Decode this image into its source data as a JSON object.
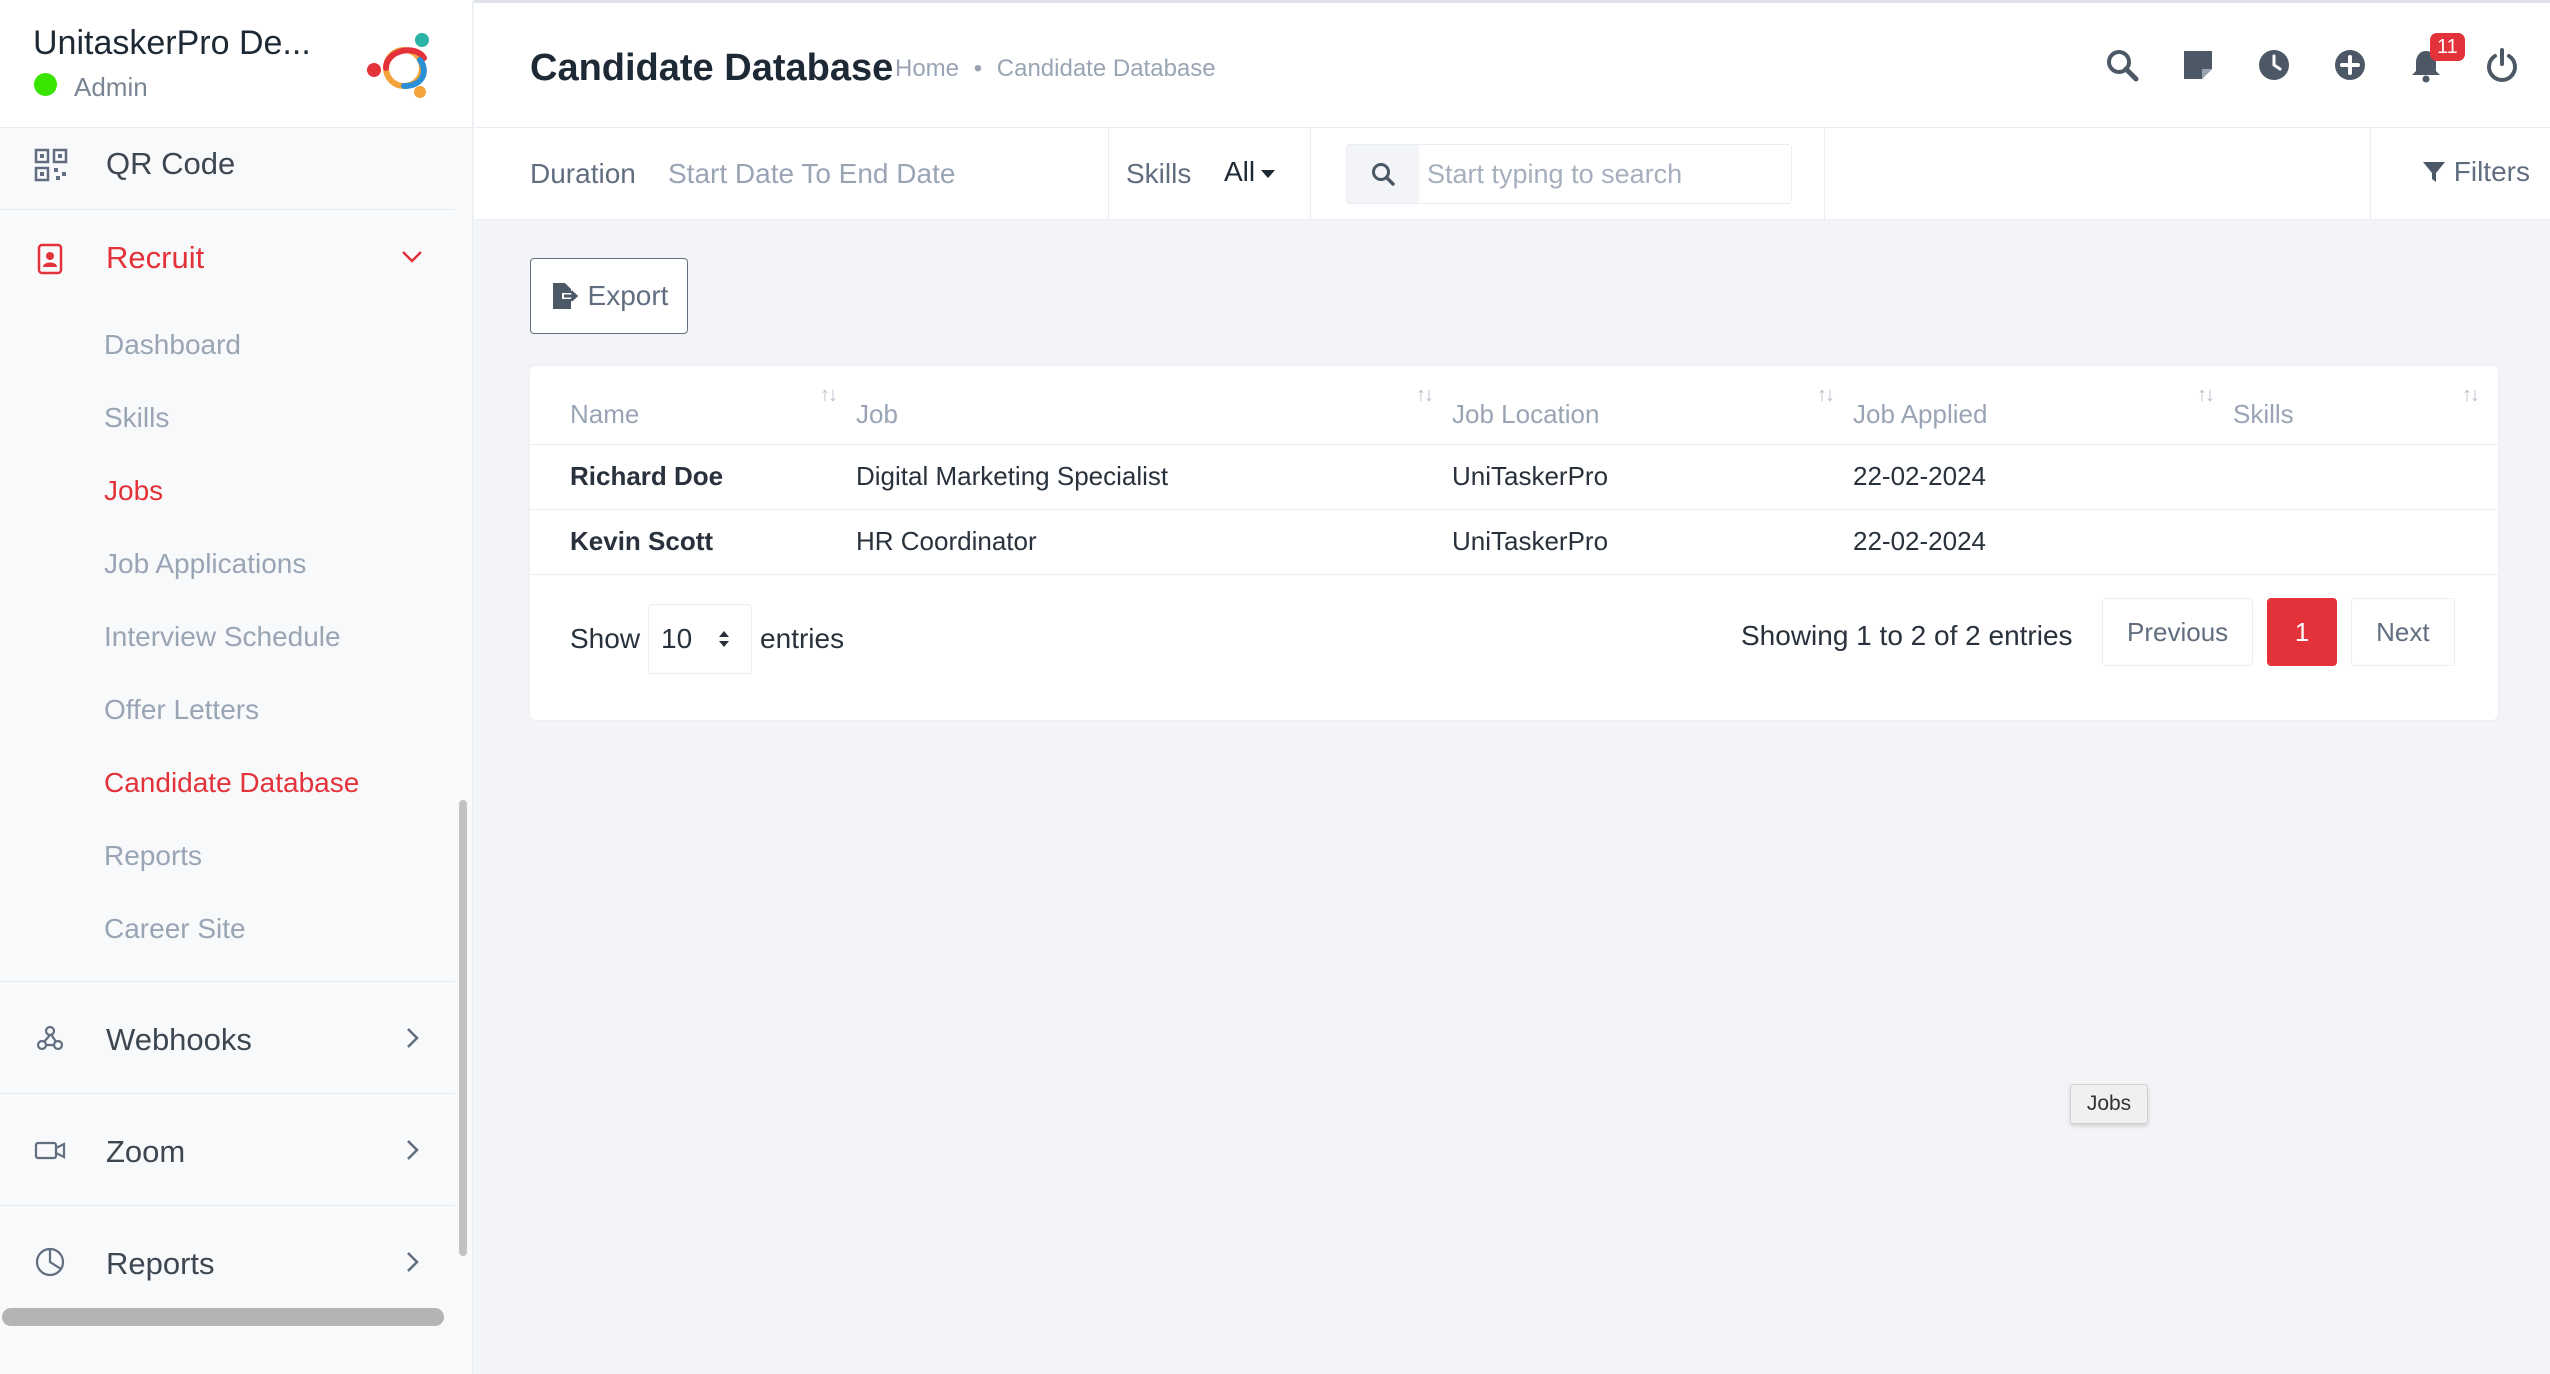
{
  "sidebar": {
    "company_name": "UnitaskerPro De...",
    "role": "Admin",
    "status_color": "#39e500",
    "top_item": {
      "label": "QR Code",
      "icon": "qr-code-icon"
    },
    "recruit": {
      "label": "Recruit",
      "icon": "recruit-icon",
      "items": [
        {
          "label": "Dashboard"
        },
        {
          "label": "Skills"
        },
        {
          "label": "Jobs"
        },
        {
          "label": "Job Applications"
        },
        {
          "label": "Interview Schedule"
        },
        {
          "label": "Offer Letters"
        },
        {
          "label": "Candidate Database"
        },
        {
          "label": "Reports"
        },
        {
          "label": "Career Site"
        }
      ]
    },
    "webhooks": {
      "label": "Webhooks",
      "icon": "webhooks-icon"
    },
    "zoom": {
      "label": "Zoom",
      "icon": "zoom-icon"
    },
    "reports": {
      "label": "Reports",
      "icon": "pie-chart-icon"
    }
  },
  "header": {
    "title": "Candidate Database",
    "breadcrumb": {
      "home": "Home",
      "separator": "•",
      "current": "Candidate Database"
    },
    "notification_count": "11",
    "accent_color": "#e3323a"
  },
  "filters": {
    "duration_label": "Duration",
    "duration_value": "Start Date To End Date",
    "skills_label": "Skills",
    "skills_value": "All",
    "search_placeholder": "Start typing to search",
    "filters_label": "Filters"
  },
  "toolbar": {
    "export_label": "Export"
  },
  "table": {
    "columns": [
      "Name",
      "Job",
      "Job Location",
      "Job Applied",
      "Skills"
    ],
    "rows": [
      {
        "name": "Richard Doe",
        "job": "Digital Marketing Specialist",
        "location": "UniTaskerPro",
        "applied": "22-02-2024",
        "skills": ""
      },
      {
        "name": "Kevin Scott",
        "job": "HR Coordinator",
        "location": "UniTaskerPro",
        "applied": "22-02-2024",
        "skills": ""
      }
    ],
    "show_label": "Show",
    "page_length": "10",
    "entries_label": "entries",
    "info": "Showing 1 to 2 of 2 entries",
    "prev_label": "Previous",
    "current_page": "1",
    "next_label": "Next"
  },
  "tooltip": "Jobs"
}
